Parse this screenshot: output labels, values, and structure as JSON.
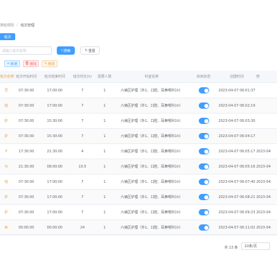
{
  "breadcrumb": {
    "parent": "排班规则",
    "current": "班次管理"
  },
  "tag_label": "班次",
  "search": {
    "placeholder": "请输入班次名称"
  },
  "buttons": {
    "search": "搜索",
    "reset": "重置",
    "add": "新增",
    "delete": "删除",
    "edit": "修改"
  },
  "table": {
    "headers": [
      "班次名称",
      "班次开始时间",
      "班次结束时间",
      "班次时长(h)",
      "需要人数",
      "科室名称",
      "启用状态",
      "创建时间",
      "修"
    ],
    "rows": [
      {
        "name": "早",
        "start": "07:30:00",
        "end": "17:00:00",
        "hours": "7",
        "people": "1",
        "dept": "六病区护理（外1、口腔、耳鼻喉科1h）",
        "enabled": true,
        "created": "2023-04-07 06:01:37",
        "extra": ""
      },
      {
        "name": "班",
        "start": "07:30:00",
        "end": "17:00:00",
        "hours": "7",
        "people": "1",
        "dept": "六病区护理（外1、口腔、耳鼻喉科1h）",
        "enabled": true,
        "created": "2023-04-07 06:02:19",
        "extra": ""
      },
      {
        "name": "护",
        "start": "07:30:00",
        "end": "15:30:00",
        "hours": "7",
        "people": "1",
        "dept": "六病区护理（外1、口腔、耳鼻喉科1h）",
        "enabled": true,
        "created": "2023-04-07 06:03:30",
        "extra": ""
      },
      {
        "name": "护",
        "start": "07:30:00",
        "end": "15:30:00",
        "hours": "7",
        "people": "1",
        "dept": "六病区护理（外1、口腔、耳鼻喉科1h）",
        "enabled": true,
        "created": "2023-04-07 06:04:17",
        "extra": ""
      },
      {
        "name": "P",
        "start": "17:30:00",
        "end": "21:30:00",
        "hours": "4",
        "people": "1",
        "dept": "六病区护理（外1、口腔、耳鼻喉科1h）",
        "enabled": true,
        "created": "2023-04-07 06:05:17",
        "extra": "2023-04"
      },
      {
        "name": "N",
        "start": "21:30:00",
        "end": "08:00:00",
        "hours": "10.5",
        "people": "1",
        "dept": "六病区护理（外1、口腔、耳鼻喉科1h）",
        "enabled": true,
        "created": "2023-04-07 06:05:16",
        "extra": "2023-04"
      },
      {
        "name": "班",
        "start": "07:30:00",
        "end": "17:00:00",
        "hours": "7",
        "people": "1",
        "dept": "六病区护理（外1、口腔、耳鼻喉科1h）",
        "enabled": true,
        "created": "2023-04-07 06:07:40",
        "extra": "2023-04"
      },
      {
        "name": "护",
        "start": "07:30:00",
        "end": "17:00:00",
        "hours": "7",
        "people": "1",
        "dept": "六病区护理（外1、口腔、耳鼻喉科1h）",
        "enabled": true,
        "created": "2023-04-07 06:08:21",
        "extra": "2023-04"
      },
      {
        "name": "护",
        "start": "07:30:00",
        "end": "17:00:00",
        "hours": "7",
        "people": "1",
        "dept": "六病区护理（外1、口腔、耳鼻喉科1h）",
        "enabled": true,
        "created": "2023-04-07 06:09:23",
        "extra": "2023-04"
      },
      {
        "name": "休",
        "start": "00:00:00",
        "end": "00:00:00",
        "hours": "24",
        "people": "1",
        "dept": "六病区护理（外1、口腔、耳鼻喉科1h）",
        "enabled": true,
        "created": "2023-04-07 06:11:02",
        "extra": "2023-04"
      }
    ]
  },
  "pagination": {
    "total": "共 13 条",
    "page_size": "10条/页"
  },
  "colors": {
    "primary": "#409eff",
    "danger": "#f56c6c",
    "warning": "#e6a23c"
  }
}
